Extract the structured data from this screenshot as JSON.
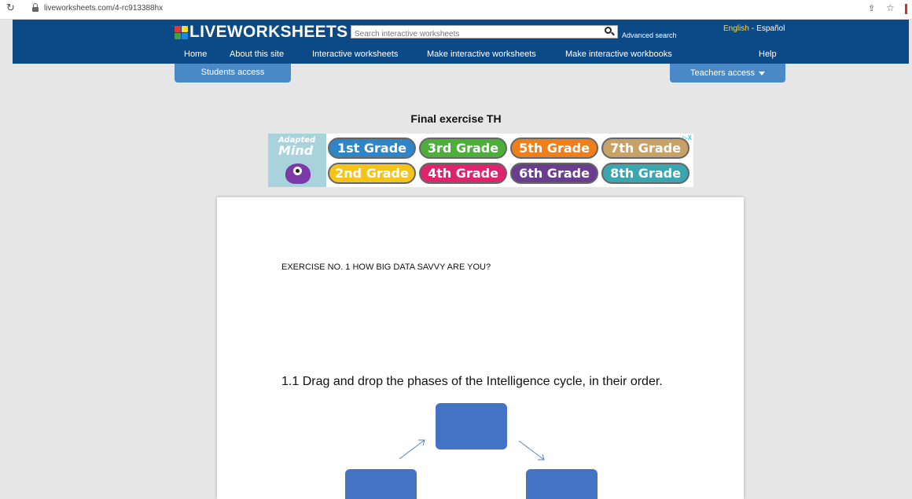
{
  "browser": {
    "url": "liveworksheets.com/4-rc913388hx"
  },
  "header": {
    "logo_text": "LIVEWORKSHEETS",
    "search_placeholder": "Search interactive worksheets",
    "advanced_search": "Advanced search",
    "lang_en": "English",
    "lang_sep": "-",
    "lang_es": "Español"
  },
  "nav": {
    "home": "Home",
    "about": "About this site",
    "interactive": "Interactive worksheets",
    "make": "Make interactive worksheets",
    "workbooks": "Make interactive workbooks",
    "help": "Help"
  },
  "access": {
    "students": "Students access",
    "teachers": "Teachers access"
  },
  "page_title": "Final exercise TH",
  "ad": {
    "brand_line1": "Adapted",
    "brand_line2": "Mind",
    "close": "▷X",
    "grades": [
      {
        "label": "1st Grade",
        "color": "#2e86c9"
      },
      {
        "label": "3rd Grade",
        "color": "#4caf3a"
      },
      {
        "label": "5th Grade",
        "color": "#f07f1b"
      },
      {
        "label": "7th Grade",
        "color": "#c8a166"
      },
      {
        "label": "2nd Grade",
        "color": "#f6c319"
      },
      {
        "label": "4th Grade",
        "color": "#e0236d"
      },
      {
        "label": "6th Grade",
        "color": "#6a3d8f"
      },
      {
        "label": "8th Grade",
        "color": "#3aa6b0"
      }
    ]
  },
  "worksheet": {
    "exercise_heading": "EXERCISE NO. 1 HOW BIG DATA SAVVY ARE YOU?",
    "instruction": "1.1 Drag and drop the phases of the Intelligence cycle, in their order."
  },
  "colors": {
    "header_bg": "#0c4a87",
    "tab_bg": "#4a89c8",
    "drop_box": "#4472c4"
  }
}
